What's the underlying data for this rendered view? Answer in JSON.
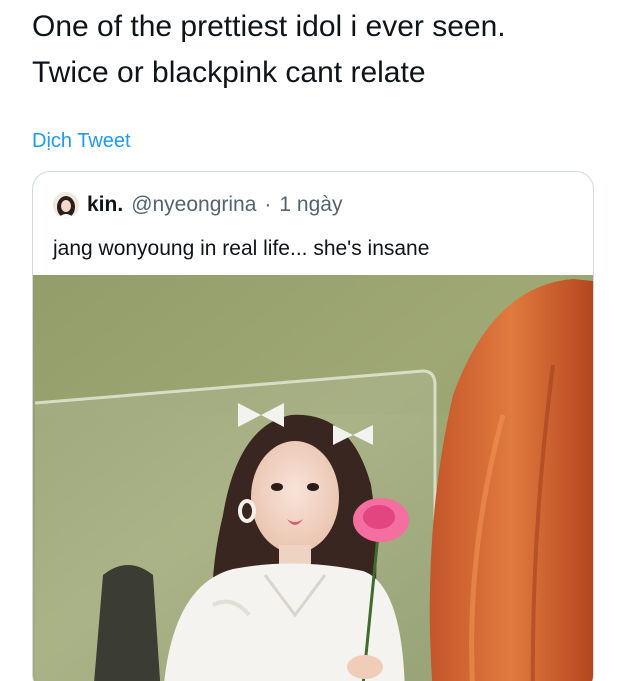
{
  "tweet": {
    "text_line_1": "One of the prettiest idol i ever seen.",
    "text_line_2": "Twice or blackpink cant relate",
    "translate_label": "Dịch Tweet"
  },
  "quoted_tweet": {
    "author_name": "kin.",
    "author_handle": "@nyeongrina",
    "separator": "·",
    "timestamp": "1 ngày",
    "text": "jang wonyoung in real life... she's insane"
  },
  "colors": {
    "link": "#1d9bf0",
    "text_primary": "#0f1419",
    "text_secondary": "#536471",
    "card_border": "#cfd9de"
  },
  "icons": [
    "avatar-image",
    "photo-media"
  ]
}
